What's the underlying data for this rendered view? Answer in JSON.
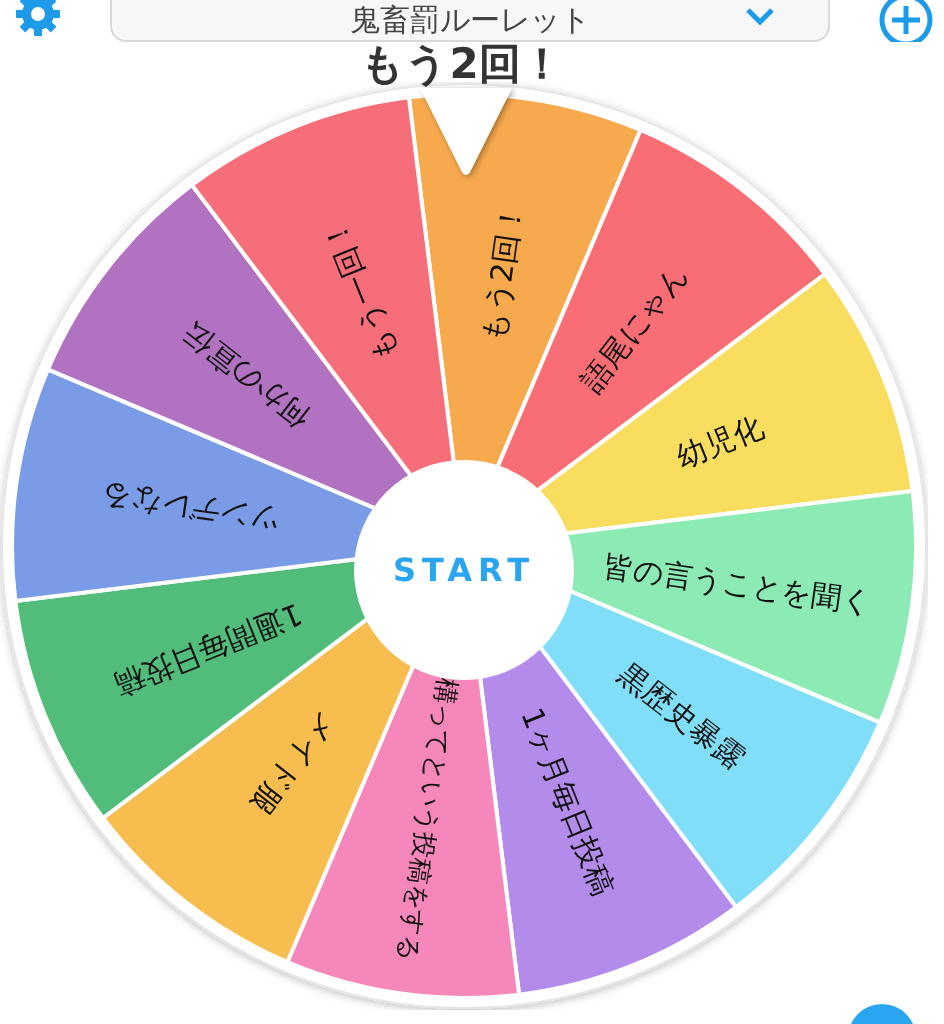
{
  "header": {
    "title": "鬼畜罰ルーレット"
  },
  "result": "もう2回！",
  "wheel": {
    "start_label": "START",
    "segments": [
      {
        "label": "もう2回！",
        "color": "#f7a94e"
      },
      {
        "label": "語尾にゃん",
        "color": "#f86e74"
      },
      {
        "label": "幼児化",
        "color": "#f9dd5e"
      },
      {
        "label": "皆の言うことを聞く",
        "color": "#8ceab4"
      },
      {
        "label": "黒歴史暴露",
        "color": "#80def8"
      },
      {
        "label": "1ヶ月毎日投稿",
        "color": "#b38beb"
      },
      {
        "label": "構ってという投稿をする",
        "color": "#f687ba"
      },
      {
        "label": "メイド服",
        "color": "#f7bd4f"
      },
      {
        "label": "1週間毎日投稿",
        "color": "#52bd7a"
      },
      {
        "label": "ツンデレなる",
        "color": "#7a9ce6"
      },
      {
        "label": "何かの宣伝",
        "color": "#b172c2"
      },
      {
        "label": "もう一回！",
        "color": "#f66e79"
      }
    ]
  }
}
